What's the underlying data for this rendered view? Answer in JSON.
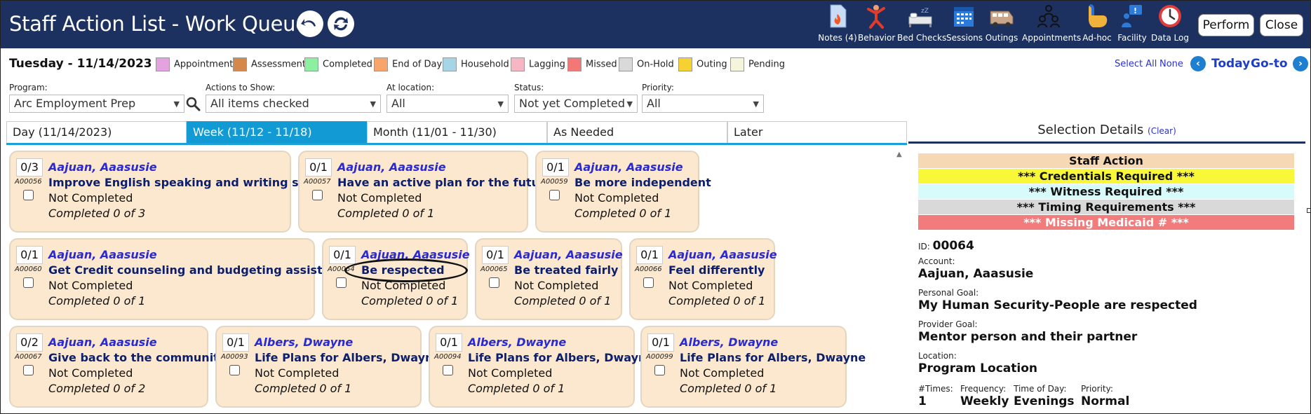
{
  "header": {
    "title": "Staff Action List - Work Queue",
    "back_icon": "undo-arrow-icon",
    "refresh_icon": "refresh-icon",
    "tools": [
      {
        "label": "Notes (4)",
        "icon": "notes-icon"
      },
      {
        "label": "Behavior",
        "icon": "behavior-icon"
      },
      {
        "label": "Bed Checks",
        "icon": "bed-icon"
      },
      {
        "label": "Sessions",
        "icon": "calendar-icon"
      },
      {
        "label": "Outings",
        "icon": "van-icon"
      },
      {
        "label": "Appointments",
        "icon": "people-icon"
      },
      {
        "label": "Ad-hoc",
        "icon": "hand-icon"
      },
      {
        "label": "Facility",
        "icon": "facility-icon"
      },
      {
        "label": "Data Log",
        "icon": "clock-icon"
      }
    ],
    "perform_label": "Perform",
    "close_label": "Close",
    "colors": {
      "header_bg": "#1c3160"
    }
  },
  "datebar": {
    "date": "Tuesday - 11/14/2023",
    "legend": [
      {
        "label": "Appointment",
        "color": "#e5a2e0"
      },
      {
        "label": "Assessment",
        "color": "#d4894b"
      },
      {
        "label": "Completed",
        "color": "#8cf0a0"
      },
      {
        "label": "End of Day",
        "color": "#f7a56a"
      },
      {
        "label": "Household",
        "color": "#a6d6e6"
      },
      {
        "label": "Lagging",
        "color": "#f6b6c4"
      },
      {
        "label": "Missed",
        "color": "#f27878"
      },
      {
        "label": "On-Hold",
        "color": "#d9d9d9"
      },
      {
        "label": "Outing",
        "color": "#f5d131"
      },
      {
        "label": "Pending",
        "color": "#f5f5dc"
      }
    ],
    "select_all": "Select All",
    "none": "None",
    "prev_arrow": "‹",
    "today": "Today",
    "goto": "Go-to",
    "next_arrow": "›"
  },
  "filters": {
    "program": {
      "label": "Program:",
      "value": "Arc Employment Prep"
    },
    "actions": {
      "label": "Actions to Show:",
      "value": "All items checked"
    },
    "location": {
      "label": "At location:",
      "value": "All"
    },
    "status": {
      "label": "Status:",
      "value": "Not yet Completed"
    },
    "priority": {
      "label": "Priority:",
      "value": "All"
    }
  },
  "tabs": [
    {
      "label": "Day (11/14/2023)",
      "active": false
    },
    {
      "label": "Week (11/12 - 11/18)",
      "active": true
    },
    {
      "label": "Month (11/01 - 11/30)",
      "active": false
    },
    {
      "label": "As Needed",
      "active": false
    },
    {
      "label": "Later",
      "active": false
    }
  ],
  "cards": [
    {
      "count": "0/3",
      "id": "A00056",
      "account": "Aajuan, Aaasusie",
      "goal": "Improve English speaking and writing skills",
      "status": "Not Completed",
      "completed": "Completed 0 of 3"
    },
    {
      "count": "0/1",
      "id": "A00057",
      "account": "Aajuan, Aaasusie",
      "goal": "Have an active plan for the future",
      "status": "Not Completed",
      "completed": "Completed 0 of 1"
    },
    {
      "count": "0/1",
      "id": "A00059",
      "account": "Aajuan, Aaasusie",
      "goal": "Be more independent",
      "status": "Not Completed",
      "completed": "Completed 0 of 1"
    },
    {
      "count": "0/1",
      "id": "A00060",
      "account": "Aajuan, Aaasusie",
      "goal": "Get Credit counseling and budgeting assistance",
      "status": "Not Completed",
      "completed": "Completed 0 of 1"
    },
    {
      "count": "0/1",
      "id": "A00064",
      "account": "Aajuan, Aaasusie",
      "goal": "Be respected",
      "status": "Not Completed",
      "completed": "Completed 0 of 1"
    },
    {
      "count": "0/1",
      "id": "A00065",
      "account": "Aajuan, Aaasusie",
      "goal": "Be treated fairly",
      "status": "Not Completed",
      "completed": "Completed 0 of 1"
    },
    {
      "count": "0/1",
      "id": "A00066",
      "account": "Aajuan, Aaasusie",
      "goal": "Feel differently",
      "status": "Not Completed",
      "completed": "Completed 0 of 1"
    },
    {
      "count": "0/2",
      "id": "A00067",
      "account": "Aajuan, Aaasusie",
      "goal": "Give back to the community",
      "status": "Not Completed",
      "completed": "Completed 0 of 2"
    },
    {
      "count": "0/1",
      "id": "A00093",
      "account": "Albers, Dwayne",
      "goal": "Life Plans for Albers, Dwayne",
      "status": "Not Completed",
      "completed": "Completed 0 of 1"
    },
    {
      "count": "0/1",
      "id": "A00094",
      "account": "Albers, Dwayne",
      "goal": "Life Plans for Albers, Dwayne",
      "status": "Not Completed",
      "completed": "Completed 0 of 1"
    },
    {
      "count": "0/1",
      "id": "A00099",
      "account": "Albers, Dwayne",
      "goal": "Life Plans for Albers, Dwayne",
      "status": "Not Completed",
      "completed": "Completed 0 of 1"
    }
  ],
  "details": {
    "title": "Selection Details",
    "clear": "(Clear)",
    "banners": [
      {
        "text": "Staff Action",
        "color": "#f6d9b4"
      },
      {
        "text": "*** Credentials Required ***",
        "color": "#f8f839"
      },
      {
        "text": "*** Witness Required ***",
        "color": "#d7fbfb"
      },
      {
        "text": "*** Timing Requirements ***",
        "color": "#d9d9d9"
      },
      {
        "text": "*** Missing Medicaid # ***",
        "color": "#f27b7b"
      }
    ],
    "id_label": "ID:",
    "id_value": "00064",
    "account_label": "Account:",
    "account_value": "Aajuan, Aaasusie",
    "personal_goal_label": "Personal Goal:",
    "personal_goal_value": "My Human Security-People are respected",
    "provider_goal_label": "Provider Goal:",
    "provider_goal_value": "Mentor person and their partner",
    "location_label": "Location:",
    "location_value": "Program Location",
    "times_label": "#Times:",
    "times_value": "1",
    "frequency_label": "Frequency:",
    "frequency_value": "Weekly",
    "tod_label": "Time of Day:",
    "tod_value": "Evenings",
    "priority_label": "Priority:",
    "priority_value": "Normal"
  }
}
